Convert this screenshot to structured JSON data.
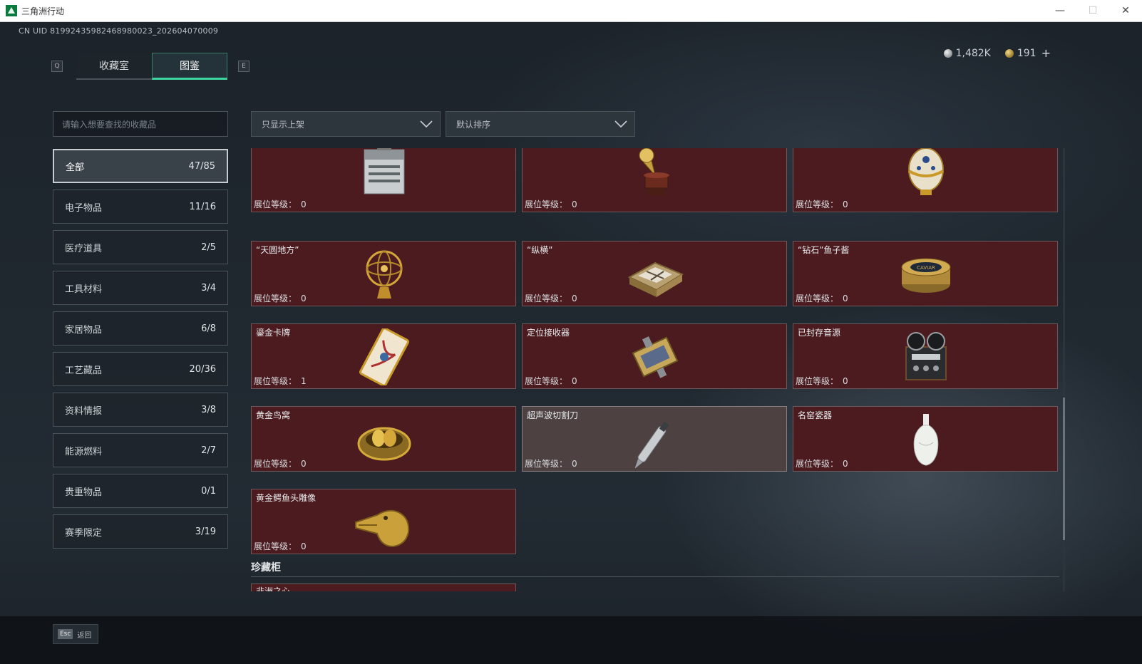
{
  "window": {
    "title": "三角洲行动",
    "minimize": "—",
    "maximize": "☐",
    "close": "✕"
  },
  "uid": "CN UID 819924359824689800​23_202604070009",
  "currency": {
    "silver": "1,482K",
    "gold": "191",
    "add": "+"
  },
  "keys": {
    "prev": "Q",
    "next": "E"
  },
  "tabs": [
    {
      "label": "收藏室"
    },
    {
      "label": "图鉴"
    }
  ],
  "active_tab": "图鉴",
  "search": {
    "placeholder": "请输入想要查找的收藏品"
  },
  "filters": {
    "shelf": "只显示上架",
    "sort": "默认排序"
  },
  "categories": [
    {
      "label": "全部",
      "count": "47/85"
    },
    {
      "label": "电子物品",
      "count": "11/16"
    },
    {
      "label": "医疗道具",
      "count": "2/5"
    },
    {
      "label": "工具材料",
      "count": "3/4"
    },
    {
      "label": "家居物品",
      "count": "6/8"
    },
    {
      "label": "工艺藏品",
      "count": "20/36"
    },
    {
      "label": "资料情报",
      "count": "3/8"
    },
    {
      "label": "能源燃料",
      "count": "2/7"
    },
    {
      "label": "贵重物品",
      "count": "0/1"
    },
    {
      "label": "赛季限定",
      "count": "3/19"
    }
  ],
  "level_label": "展位等级：",
  "items": [
    {
      "name": "",
      "level": "0",
      "icon": "battery-icon"
    },
    {
      "name": "",
      "level": "0",
      "icon": "gramophone-icon"
    },
    {
      "name": "",
      "level": "0",
      "icon": "jeweled-egg-icon"
    },
    {
      "name": "“天圆地方”",
      "level": "0",
      "icon": "armillary-sphere-icon"
    },
    {
      "name": "“纵横”",
      "level": "0",
      "icon": "chessboard-icon"
    },
    {
      "name": "“钻石”鱼子酱",
      "level": "0",
      "icon": "caviar-tin-icon"
    },
    {
      "name": "鎏金卡牌",
      "level": "1",
      "icon": "gilded-card-icon"
    },
    {
      "name": "定位接收器",
      "level": "0",
      "icon": "receiver-icon"
    },
    {
      "name": "已封存音源",
      "level": "0",
      "icon": "reel-recorder-icon"
    },
    {
      "name": "黄金鸟窝",
      "level": "0",
      "icon": "golden-nest-icon"
    },
    {
      "name": "超声波切割刀",
      "level": "0",
      "icon": "ultrasonic-knife-icon"
    },
    {
      "name": "名窑瓷器",
      "level": "0",
      "icon": "porcelain-vase-icon"
    },
    {
      "name": "黄金鳄鱼头雕像",
      "level": "0",
      "icon": "gold-crocodile-icon"
    }
  ],
  "section": {
    "title": "珍藏柜",
    "peek_item": "非洲之心"
  },
  "footer": {
    "esc_key": "Esc",
    "esc_label": "返回"
  },
  "colors": {
    "accent": "#3ed6a0",
    "card_bg": "#4b1b1f",
    "card_gray": "#4d4142"
  }
}
